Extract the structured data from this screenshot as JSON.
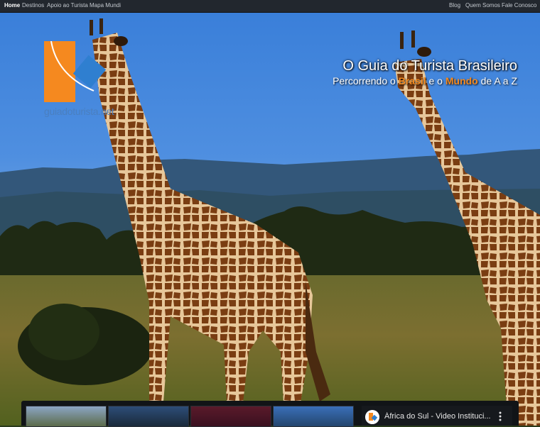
{
  "nav": {
    "left": [
      "Home",
      "Destinos",
      "Apoio ao Turista",
      "Mapa Mundi"
    ],
    "right": [
      "Blog",
      "Quem Somos",
      "Fale Conosco"
    ]
  },
  "logo": {
    "text": "guiadoturista.net"
  },
  "hero": {
    "title": "O Guia do Turista Brasileiro",
    "sub_part1": "Percorrendo o ",
    "sub_hl1": "Brasil",
    "sub_part2": " e o ",
    "sub_hl2": "Mundo",
    "sub_part3": " de A a Z"
  },
  "video": {
    "title": "África do Sul - Video Instituci..."
  },
  "colors": {
    "accent": "#f58a1f",
    "logo_blue": "#2f7fd0",
    "nav_bg": "#22272e"
  },
  "icons": [
    "guiadoturista-logo-icon",
    "video-channel-icon",
    "more-options-icon"
  ]
}
